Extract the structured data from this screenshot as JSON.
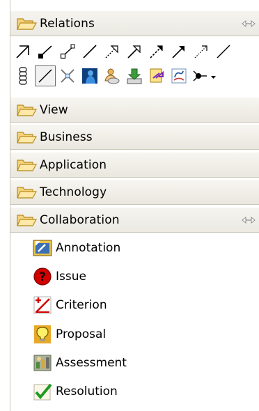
{
  "palette": {
    "relations": {
      "label": "Relations"
    },
    "view": {
      "label": "View"
    },
    "business": {
      "label": "Business"
    },
    "application": {
      "label": "Application"
    },
    "technology": {
      "label": "Technology"
    },
    "collaboration": {
      "label": "Collaboration",
      "items": [
        {
          "label": "Annotation",
          "icon": "annotation-icon"
        },
        {
          "label": "Issue",
          "icon": "issue-icon"
        },
        {
          "label": "Criterion",
          "icon": "criterion-icon"
        },
        {
          "label": "Proposal",
          "icon": "proposal-icon"
        },
        {
          "label": "Assessment",
          "icon": "assessment-icon"
        },
        {
          "label": "Resolution",
          "icon": "resolution-icon"
        }
      ]
    }
  },
  "colors": {
    "header_bg": "#ece9d8",
    "border": "#c9c5b8",
    "folder": "#f4c04b",
    "issue_red": "#d40000",
    "check_green": "#1f9a1f",
    "bulb_yellow": "#fff06a"
  }
}
